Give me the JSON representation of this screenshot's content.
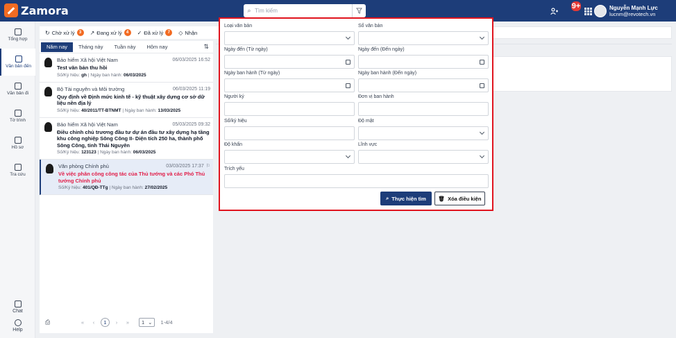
{
  "app": {
    "name": "Zamora"
  },
  "search": {
    "placeholder": "Tìm kiếm"
  },
  "header": {
    "notif_count": "9+",
    "user_name": "Nguyễn Mạnh Lực",
    "user_email": "lucnm@revotech.vn"
  },
  "sidebar": {
    "items": [
      {
        "label": "Tổng hợp"
      },
      {
        "label": "Văn bản đến"
      },
      {
        "label": "Văn bản đi"
      },
      {
        "label": "Tờ trình"
      },
      {
        "label": "Hồ sơ"
      },
      {
        "label": "Tra cứu"
      }
    ],
    "bottom": [
      {
        "label": "Chat"
      },
      {
        "label": "Help"
      }
    ]
  },
  "status_tabs": [
    {
      "label": "Chờ xử lý",
      "count": "3"
    },
    {
      "label": "Đang xử lý",
      "count": "4"
    },
    {
      "label": "Đã xử lý",
      "count": "7"
    },
    {
      "label": "Nhận"
    }
  ],
  "period_tabs": [
    "Năm nay",
    "Tháng này",
    "Tuần này",
    "Hôm nay"
  ],
  "documents": [
    {
      "org": "Bảo hiểm Xã hội Việt Nam",
      "date": "06/03/2025 16:52",
      "title": "Test văn bản thu hồi",
      "meta_label": "Số/Ký hiệu:",
      "code": "gh",
      "issued_label": "| Ngày ban hành:",
      "issued": "06/03/2025"
    },
    {
      "org": "Bộ Tài nguyên và Môi trường",
      "date": "06/03/2025 11:19",
      "title": "Quy định về Định mức kinh tế - kỹ thuật xây dựng cơ sở dữ liệu nền địa lý",
      "meta_label": "Số/Ký hiệu:",
      "code": "40/2011/TT-BTNMT",
      "issued_label": "| Ngày ban hành:",
      "issued": "13/03/2025"
    },
    {
      "org": "Bảo hiểm Xã hội Việt Nam",
      "date": "05/03/2025 09:32",
      "title": "Điều chỉnh chủ trương đầu tư dự án đầu tư xây dựng hạ tầng khu công nghiệp Sông Công II- Diện tích 250 ha, thành phố Sông Công, tỉnh Thái Nguyên",
      "meta_label": "Số/Ký hiệu:",
      "code": "123123",
      "issued_label": "| Ngày ban hành:",
      "issued": "06/03/2025"
    },
    {
      "org": "Văn phòng Chính phủ",
      "date": "03/03/2025 17:37",
      "title": "Về việc phân công công tác của Thủ tướng và các Phó Thủ tướng Chính phủ",
      "meta_label": "Số/Ký hiệu:",
      "code": "401/QĐ-TTg",
      "issued_label": "| Ngày ban hành:",
      "issued": "27/02/2025"
    }
  ],
  "pager": {
    "current": "1",
    "page_size": "1",
    "range": "1-4/4"
  },
  "filter": {
    "fields": [
      {
        "label": "Loại văn bản"
      },
      {
        "label": "Sổ văn bản"
      },
      {
        "label": "Ngày đến (Từ ngày)"
      },
      {
        "label": "Ngày đến (Đến ngày)"
      },
      {
        "label": "Ngày ban hành (Từ ngày)"
      },
      {
        "label": "Ngày ban hành (Đến ngày)"
      },
      {
        "label": "Người ký"
      },
      {
        "label": "Đơn vị ban hành"
      },
      {
        "label": "Số/ký hiệu"
      },
      {
        "label": "Độ mật"
      },
      {
        "label": "Độ khẩn"
      },
      {
        "label": "Lĩnh vực"
      },
      {
        "label": "Trích yếu"
      }
    ],
    "search_button": "Thực hiện tìm",
    "clear_button": "Xóa điều kiện"
  },
  "colors": {
    "brand": "#1d3d79",
    "accent": "#f26b22",
    "highlight_border": "#e0141e"
  }
}
